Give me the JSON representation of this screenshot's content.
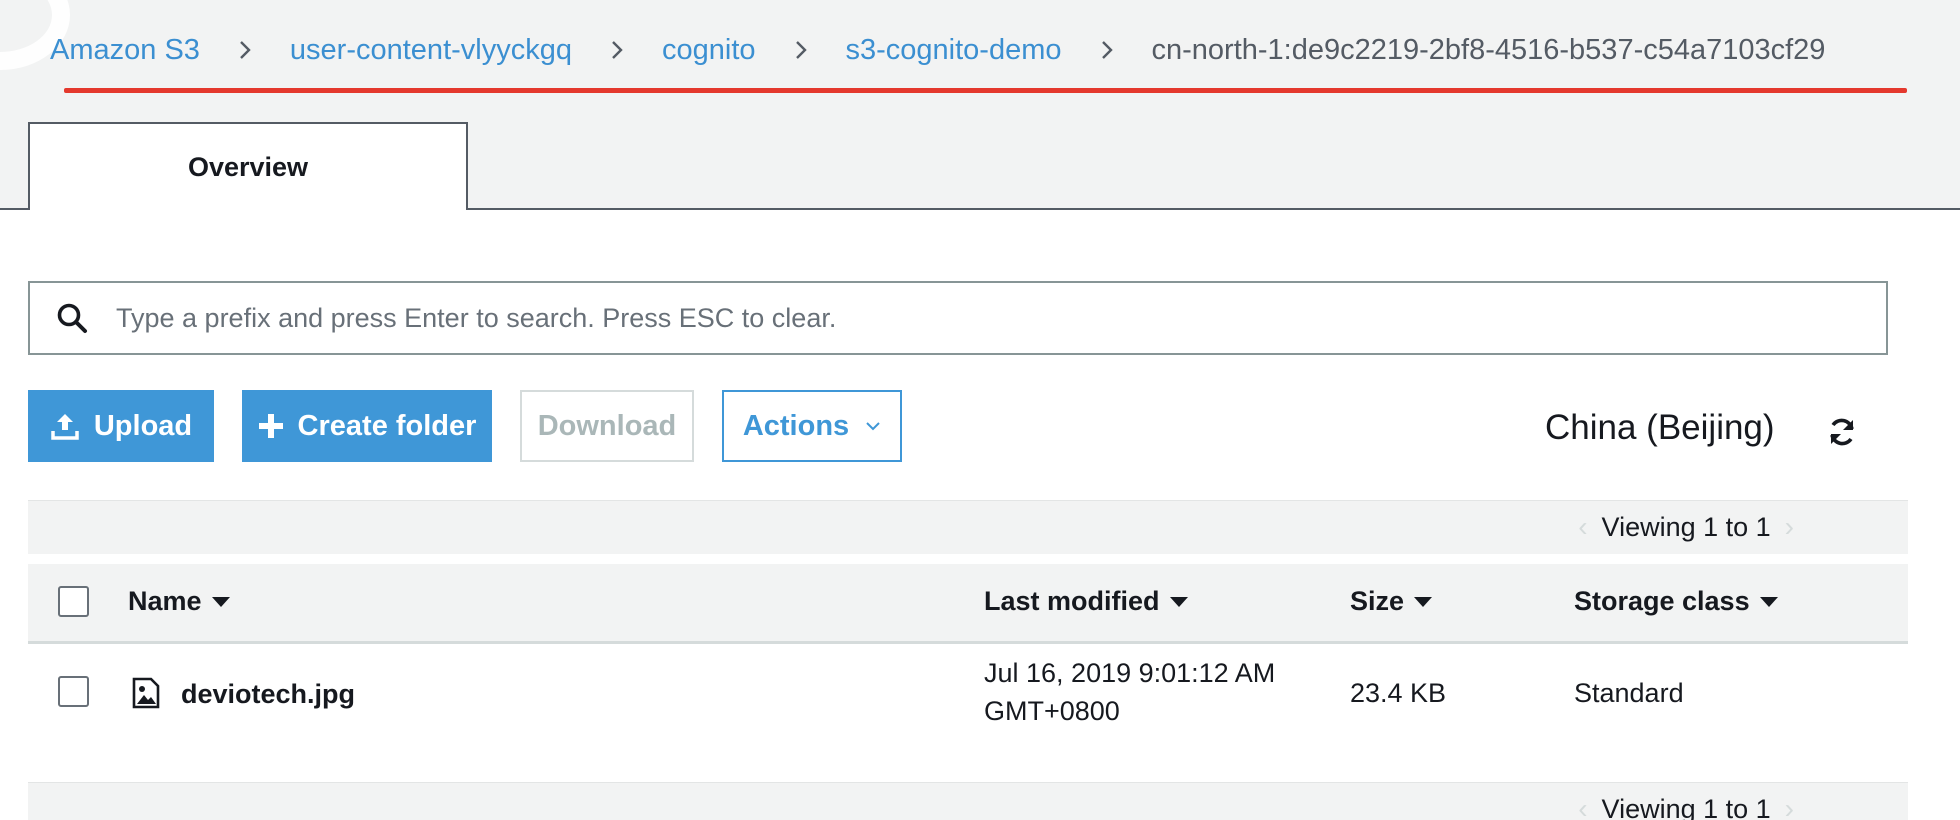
{
  "breadcrumb": {
    "items": [
      "Amazon S3",
      "user-content-vlyyckgq",
      "cognito",
      "s3-cognito-demo"
    ],
    "current": "cn-north-1:de9c2219-2bf8-4516-b537-c54a7103cf29"
  },
  "tabs": [
    {
      "label": "Overview",
      "active": true
    }
  ],
  "search": {
    "placeholder": "Type a prefix and press Enter to search. Press ESC to clear.",
    "value": ""
  },
  "toolbar": {
    "upload_label": "Upload",
    "create_folder_label": "Create folder",
    "download_label": "Download",
    "actions_label": "Actions",
    "region": "China (Beijing)"
  },
  "pagination": {
    "text": "Viewing 1 to 1"
  },
  "table": {
    "columns": [
      "Name",
      "Last modified",
      "Size",
      "Storage class"
    ],
    "rows": [
      {
        "name": "deviotech.jpg",
        "last_modified_line1": "Jul 16, 2019 9:01:12 AM",
        "last_modified_line2": "GMT+0800",
        "size": "23.4 KB",
        "storage_class": "Standard"
      }
    ]
  },
  "colors": {
    "link": "#3b8fd1",
    "primary_button": "#3f97d7",
    "active_underline": "#e4382d"
  },
  "icons": [
    "chevron-right-icon",
    "search-icon",
    "upload-icon",
    "plus-icon",
    "chevron-down-icon",
    "refresh-icon",
    "image-file-icon",
    "sort-caret-icon"
  ]
}
